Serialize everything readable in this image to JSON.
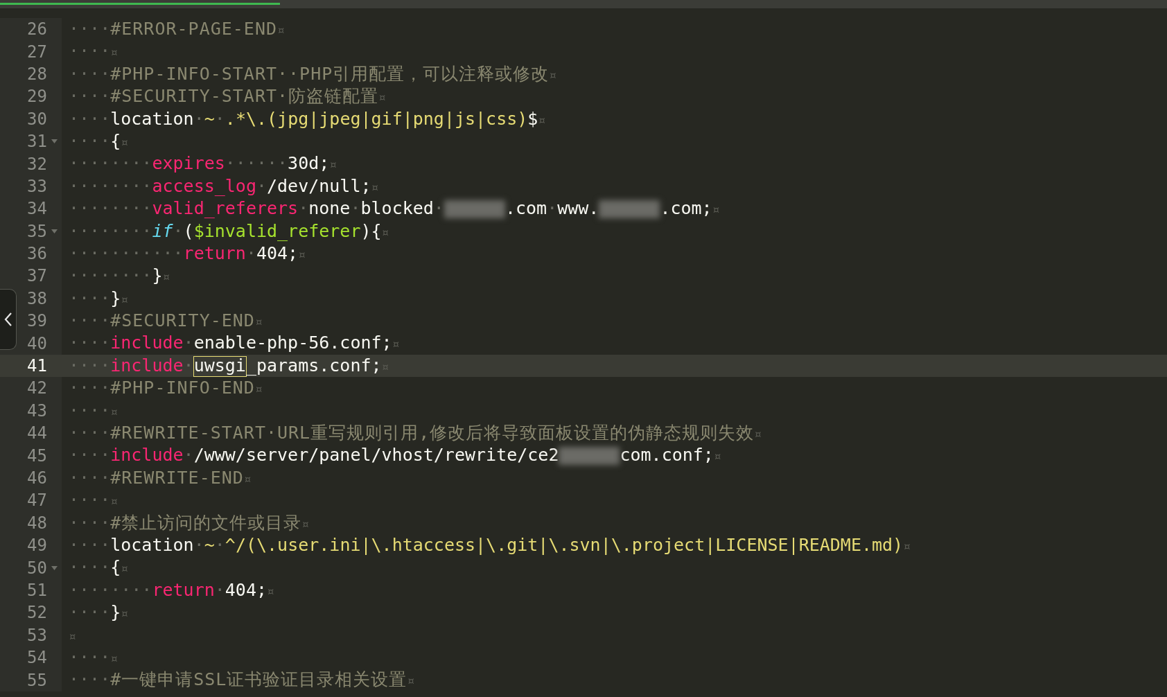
{
  "loading_bar": {
    "level": 0.24
  },
  "editor": {
    "lines": [
      {
        "number": "26",
        "current": false,
        "foldable": false,
        "tokens": [
          {
            "kind": "ws",
            "text": "····"
          },
          {
            "kind": "comment",
            "text": "#ERROR-PAGE-END"
          },
          {
            "kind": "eol",
            "text": "¤"
          }
        ]
      },
      {
        "number": "27",
        "current": false,
        "foldable": false,
        "tokens": [
          {
            "kind": "ws",
            "text": "····"
          },
          {
            "kind": "eol",
            "text": "¤"
          }
        ]
      },
      {
        "number": "28",
        "current": false,
        "foldable": false,
        "tokens": [
          {
            "kind": "ws",
            "text": "····"
          },
          {
            "kind": "comment",
            "text": "#PHP-INFO-START··PHP引用配置，可以注释或修改"
          },
          {
            "kind": "eol",
            "text": "¤"
          }
        ]
      },
      {
        "number": "29",
        "current": false,
        "foldable": false,
        "tokens": [
          {
            "kind": "ws",
            "text": "····"
          },
          {
            "kind": "comment",
            "text": "#SECURITY-START·防盗链配置"
          },
          {
            "kind": "eol",
            "text": "¤"
          }
        ]
      },
      {
        "number": "30",
        "current": false,
        "foldable": false,
        "tokens": [
          {
            "kind": "ws",
            "text": "····"
          },
          {
            "kind": "plain",
            "text": "location"
          },
          {
            "kind": "ws",
            "text": "·"
          },
          {
            "kind": "str",
            "text": "~"
          },
          {
            "kind": "ws",
            "text": "·"
          },
          {
            "kind": "str",
            "text": ".*\\.(jpg|jpeg|gif|png|js|css)"
          },
          {
            "kind": "plain",
            "text": "$"
          },
          {
            "kind": "eol",
            "text": "¤"
          }
        ]
      },
      {
        "number": "31",
        "current": false,
        "foldable": true,
        "tokens": [
          {
            "kind": "ws",
            "text": "····"
          },
          {
            "kind": "plain",
            "text": "{"
          },
          {
            "kind": "eol",
            "text": "¤"
          }
        ]
      },
      {
        "number": "32",
        "current": false,
        "foldable": false,
        "tokens": [
          {
            "kind": "ws",
            "text": "········"
          },
          {
            "kind": "kw",
            "text": "expires"
          },
          {
            "kind": "ws",
            "text": "······"
          },
          {
            "kind": "plain",
            "text": "30d;"
          },
          {
            "kind": "eol",
            "text": "¤"
          }
        ]
      },
      {
        "number": "33",
        "current": false,
        "foldable": false,
        "tokens": [
          {
            "kind": "ws",
            "text": "········"
          },
          {
            "kind": "kw",
            "text": "access_log"
          },
          {
            "kind": "ws",
            "text": "·"
          },
          {
            "kind": "plain",
            "text": "/dev/null;"
          },
          {
            "kind": "eol",
            "text": "¤"
          }
        ]
      },
      {
        "number": "34",
        "current": false,
        "foldable": false,
        "tokens": [
          {
            "kind": "ws",
            "text": "········"
          },
          {
            "kind": "kw",
            "text": "valid_referers"
          },
          {
            "kind": "ws",
            "text": "·"
          },
          {
            "kind": "plain",
            "text": "none"
          },
          {
            "kind": "ws",
            "text": "·"
          },
          {
            "kind": "plain",
            "text": "blocked"
          },
          {
            "kind": "ws",
            "text": "·"
          },
          {
            "kind": "redacted"
          },
          {
            "kind": "plain",
            "text": ".com"
          },
          {
            "kind": "ws",
            "text": "·"
          },
          {
            "kind": "plain",
            "text": "www."
          },
          {
            "kind": "redacted"
          },
          {
            "kind": "plain",
            "text": ".com;"
          },
          {
            "kind": "eol",
            "text": "¤"
          }
        ]
      },
      {
        "number": "35",
        "current": false,
        "foldable": true,
        "tokens": [
          {
            "kind": "ws",
            "text": "········"
          },
          {
            "kind": "ctrl",
            "text": "if"
          },
          {
            "kind": "ws",
            "text": "·"
          },
          {
            "kind": "plain",
            "text": "("
          },
          {
            "kind": "var",
            "text": "$invalid_referer"
          },
          {
            "kind": "plain",
            "text": "){"
          },
          {
            "kind": "eol",
            "text": "¤"
          }
        ]
      },
      {
        "number": "36",
        "current": false,
        "foldable": false,
        "tokens": [
          {
            "kind": "ws",
            "text": "···········"
          },
          {
            "kind": "kw",
            "text": "return"
          },
          {
            "kind": "ws",
            "text": "·"
          },
          {
            "kind": "plain",
            "text": "404;"
          },
          {
            "kind": "eol",
            "text": "¤"
          }
        ]
      },
      {
        "number": "37",
        "current": false,
        "foldable": false,
        "tokens": [
          {
            "kind": "ws",
            "text": "········"
          },
          {
            "kind": "plain",
            "text": "}"
          },
          {
            "kind": "eol",
            "text": "¤"
          }
        ]
      },
      {
        "number": "38",
        "current": false,
        "foldable": false,
        "tokens": [
          {
            "kind": "ws",
            "text": "····"
          },
          {
            "kind": "plain",
            "text": "}"
          },
          {
            "kind": "eol",
            "text": "¤"
          }
        ]
      },
      {
        "number": "39",
        "current": false,
        "foldable": false,
        "tokens": [
          {
            "kind": "ws",
            "text": "····"
          },
          {
            "kind": "comment",
            "text": "#SECURITY-END"
          },
          {
            "kind": "eol",
            "text": "¤"
          }
        ]
      },
      {
        "number": "40",
        "current": false,
        "foldable": false,
        "tokens": [
          {
            "kind": "ws",
            "text": "····"
          },
          {
            "kind": "kw",
            "text": "include"
          },
          {
            "kind": "ws",
            "text": "·"
          },
          {
            "kind": "plain",
            "text": "enable-php-56.conf;"
          },
          {
            "kind": "eol",
            "text": "¤"
          }
        ]
      },
      {
        "number": "41",
        "current": true,
        "foldable": false,
        "tokens": [
          {
            "kind": "ws",
            "text": "····"
          },
          {
            "kind": "kw",
            "text": "include"
          },
          {
            "kind": "ws",
            "text": "·"
          },
          {
            "kind": "match",
            "text": "uwsgi"
          },
          {
            "kind": "plain",
            "text": "_params.conf;"
          },
          {
            "kind": "eol",
            "text": "¤"
          }
        ]
      },
      {
        "number": "42",
        "current": false,
        "foldable": false,
        "tokens": [
          {
            "kind": "ws",
            "text": "····"
          },
          {
            "kind": "comment",
            "text": "#PHP-INFO-END"
          },
          {
            "kind": "eol",
            "text": "¤"
          }
        ]
      },
      {
        "number": "43",
        "current": false,
        "foldable": false,
        "tokens": [
          {
            "kind": "ws",
            "text": "····"
          },
          {
            "kind": "eol",
            "text": "¤"
          }
        ]
      },
      {
        "number": "44",
        "current": false,
        "foldable": false,
        "tokens": [
          {
            "kind": "ws",
            "text": "····"
          },
          {
            "kind": "comment",
            "text": "#REWRITE-START·URL重写规则引用,修改后将导致面板设置的伪静态规则失效"
          },
          {
            "kind": "eol",
            "text": "¤"
          }
        ]
      },
      {
        "number": "45",
        "current": false,
        "foldable": false,
        "tokens": [
          {
            "kind": "ws",
            "text": "····"
          },
          {
            "kind": "kw",
            "text": "include"
          },
          {
            "kind": "ws",
            "text": "·"
          },
          {
            "kind": "plain",
            "text": "/www/server/panel/vhost/rewrite/ce2"
          },
          {
            "kind": "redacted"
          },
          {
            "kind": "plain",
            "text": "com.conf;"
          },
          {
            "kind": "eol",
            "text": "¤"
          }
        ]
      },
      {
        "number": "46",
        "current": false,
        "foldable": false,
        "tokens": [
          {
            "kind": "ws",
            "text": "····"
          },
          {
            "kind": "comment",
            "text": "#REWRITE-END"
          },
          {
            "kind": "eol",
            "text": "¤"
          }
        ]
      },
      {
        "number": "47",
        "current": false,
        "foldable": false,
        "tokens": [
          {
            "kind": "ws",
            "text": "····"
          },
          {
            "kind": "eol",
            "text": "¤"
          }
        ]
      },
      {
        "number": "48",
        "current": false,
        "foldable": false,
        "tokens": [
          {
            "kind": "ws",
            "text": "····"
          },
          {
            "kind": "comment",
            "text": "#禁止访问的文件或目录"
          },
          {
            "kind": "eol",
            "text": "¤"
          }
        ]
      },
      {
        "number": "49",
        "current": false,
        "foldable": false,
        "tokens": [
          {
            "kind": "ws",
            "text": "····"
          },
          {
            "kind": "plain",
            "text": "location"
          },
          {
            "kind": "ws",
            "text": "·"
          },
          {
            "kind": "str",
            "text": "~"
          },
          {
            "kind": "ws",
            "text": "·"
          },
          {
            "kind": "str",
            "text": "^/(\\.user.ini|\\.htaccess|\\.git|\\.svn|\\.project|LICENSE|README.md)"
          },
          {
            "kind": "eol",
            "text": "¤"
          }
        ]
      },
      {
        "number": "50",
        "current": false,
        "foldable": true,
        "tokens": [
          {
            "kind": "ws",
            "text": "····"
          },
          {
            "kind": "plain",
            "text": "{"
          },
          {
            "kind": "eol",
            "text": "¤"
          }
        ]
      },
      {
        "number": "51",
        "current": false,
        "foldable": false,
        "tokens": [
          {
            "kind": "ws",
            "text": "········"
          },
          {
            "kind": "kw",
            "text": "return"
          },
          {
            "kind": "ws",
            "text": "·"
          },
          {
            "kind": "plain",
            "text": "404;"
          },
          {
            "kind": "eol",
            "text": "¤"
          }
        ]
      },
      {
        "number": "52",
        "current": false,
        "foldable": false,
        "tokens": [
          {
            "kind": "ws",
            "text": "····"
          },
          {
            "kind": "plain",
            "text": "}"
          },
          {
            "kind": "eol",
            "text": "¤"
          }
        ]
      },
      {
        "number": "53",
        "current": false,
        "foldable": false,
        "tokens": [
          {
            "kind": "eol",
            "text": "¤"
          }
        ]
      },
      {
        "number": "54",
        "current": false,
        "foldable": false,
        "tokens": [
          {
            "kind": "ws",
            "text": "····"
          },
          {
            "kind": "eol",
            "text": "¤"
          }
        ]
      },
      {
        "number": "55",
        "current": false,
        "foldable": false,
        "tokens": [
          {
            "kind": "ws",
            "text": "····"
          },
          {
            "kind": "comment",
            "text": "#一键申请SSL证书验证目录相关设置"
          },
          {
            "kind": "eol",
            "text": "¤"
          }
        ]
      }
    ]
  }
}
